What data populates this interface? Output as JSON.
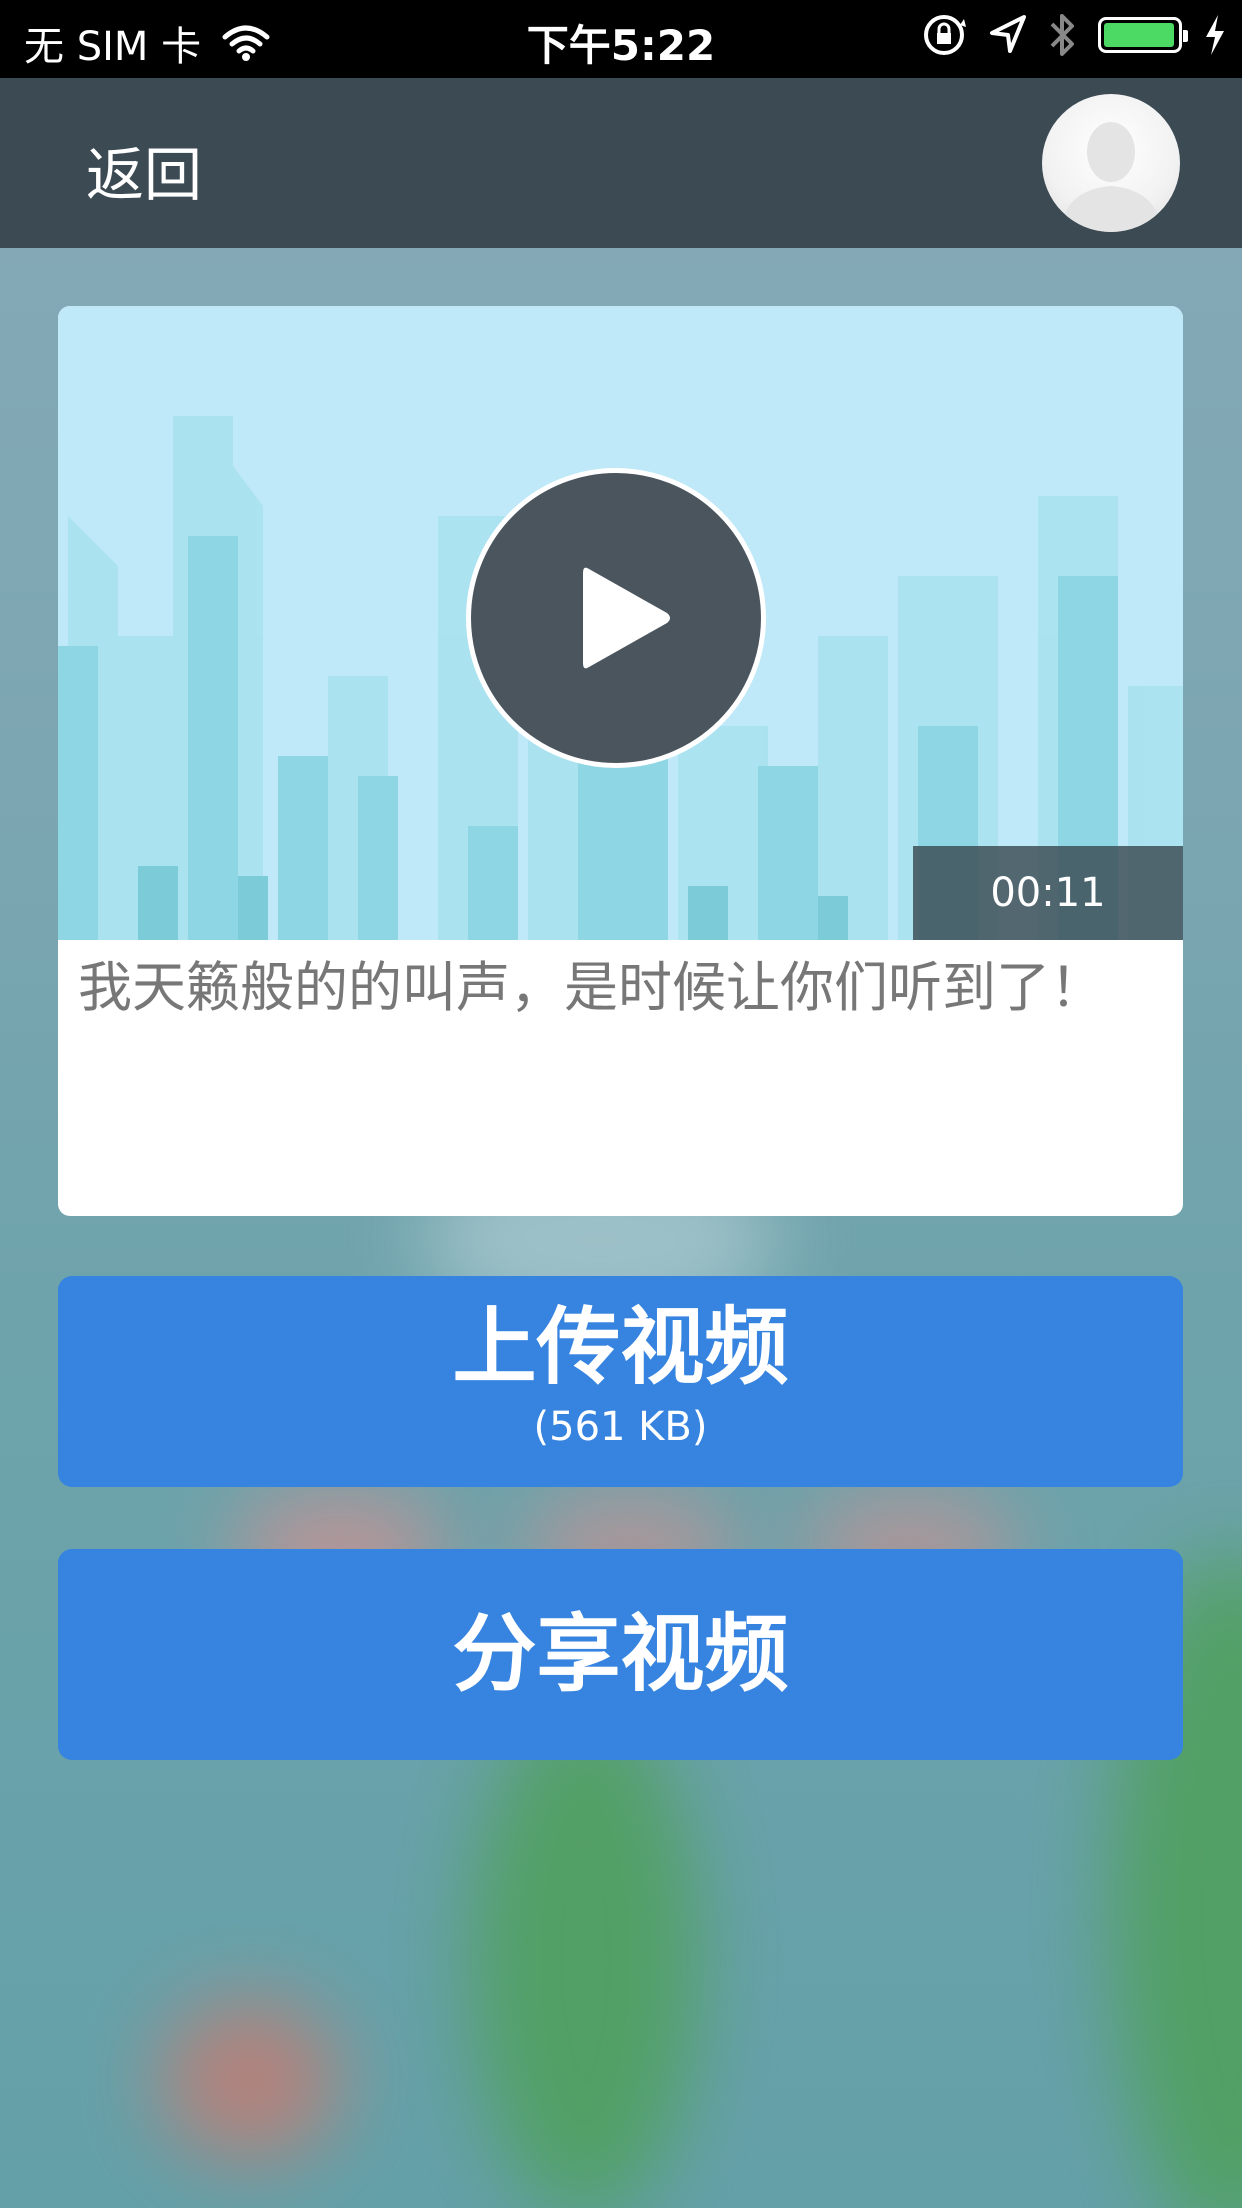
{
  "status_bar": {
    "carrier": "无 SIM 卡",
    "time": "下午5:22"
  },
  "nav": {
    "back_label": "返回"
  },
  "video": {
    "duration": "00:11",
    "caption": "我天籁般的的叫声，是时候让你们听到了！"
  },
  "actions": {
    "upload_label": "上传视频",
    "upload_size": "(561 KB)",
    "share_label": "分享视频"
  },
  "colors": {
    "nav_bg": "#3c4a54",
    "button_bg": "#3684e0",
    "battery": "#4cd964"
  }
}
